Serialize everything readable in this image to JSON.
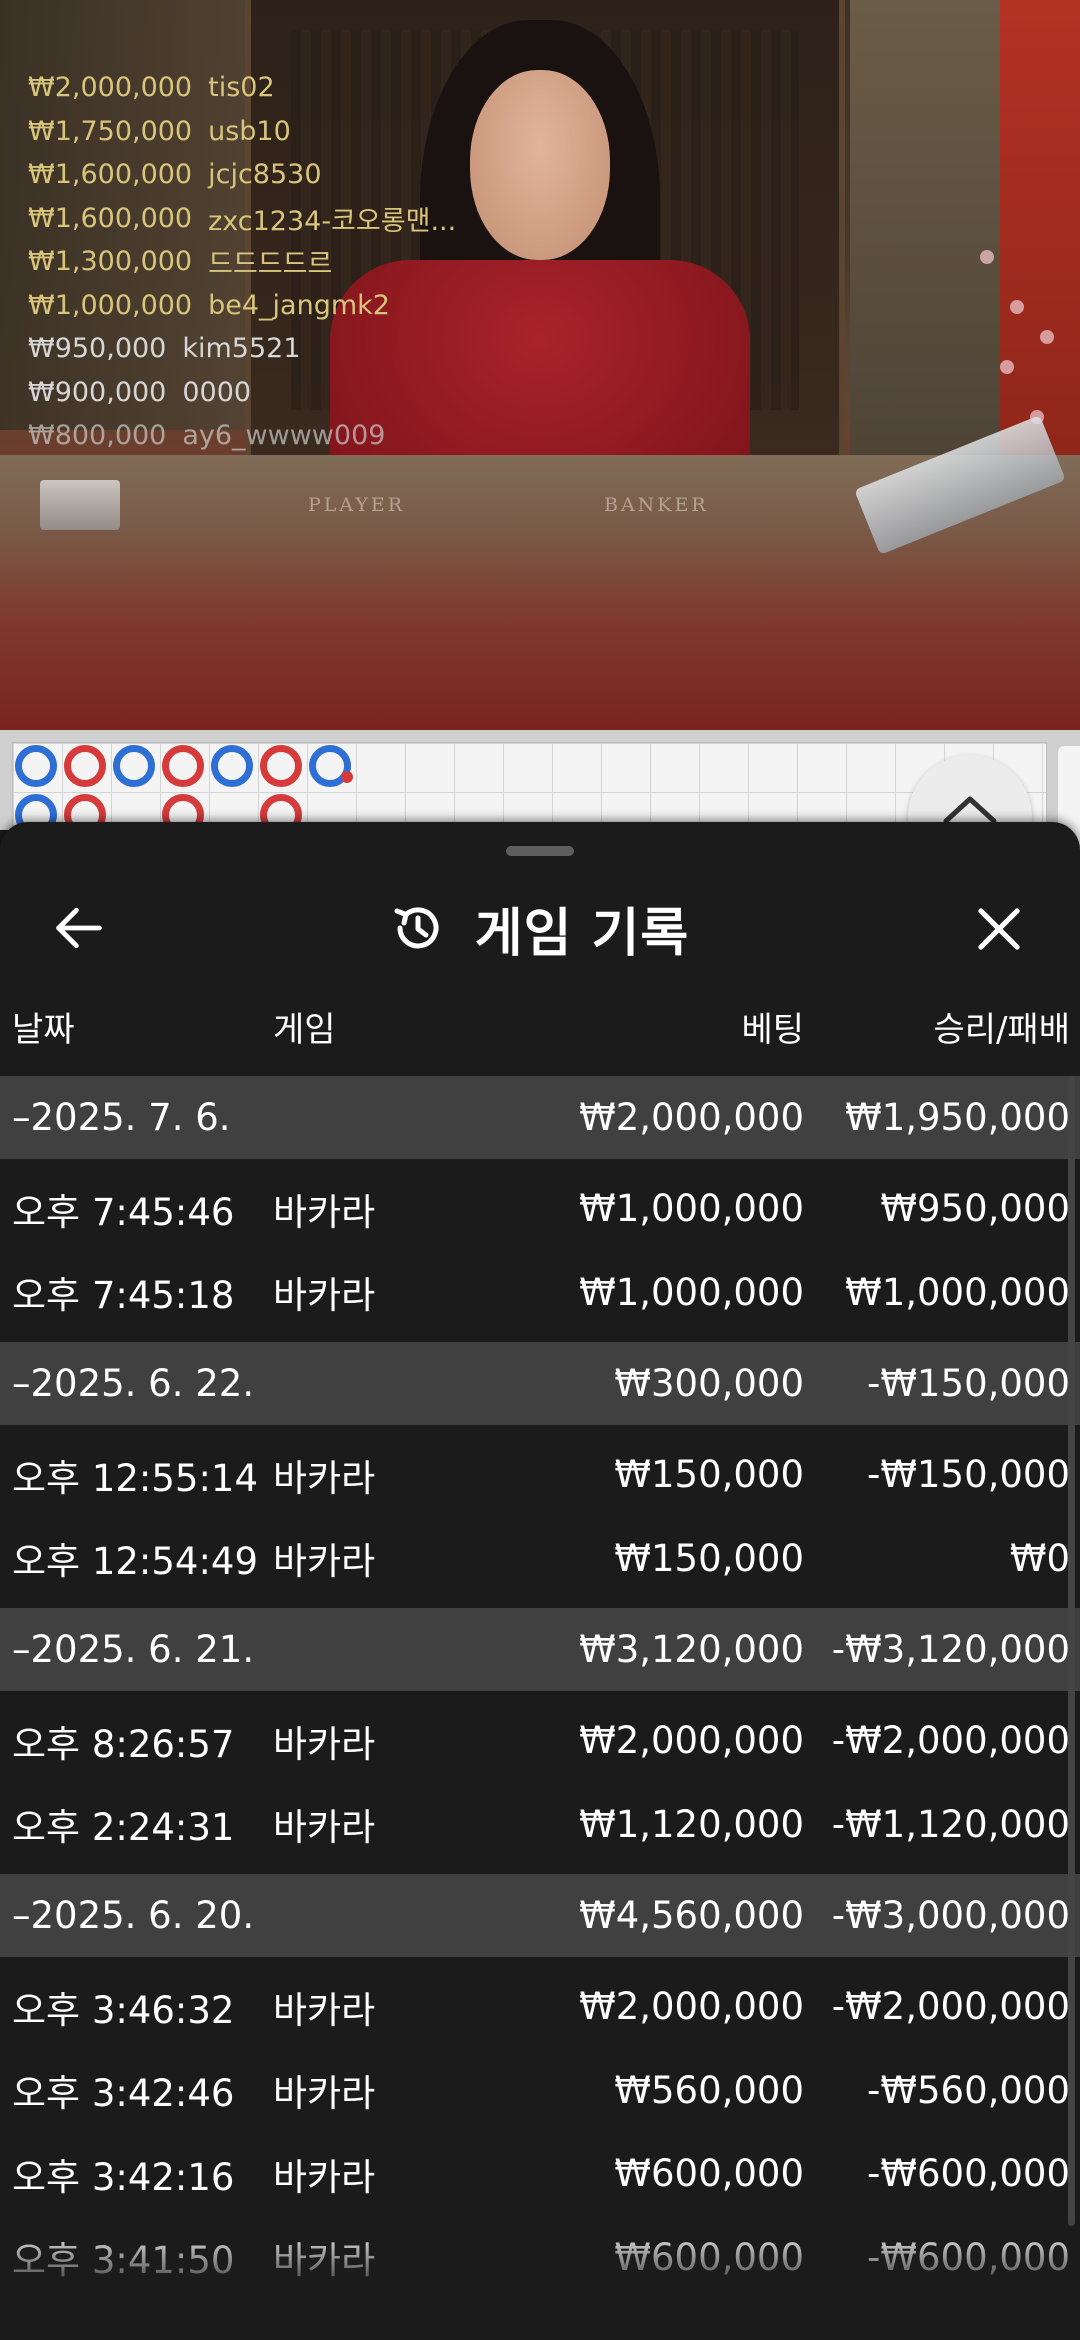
{
  "leaderboard": [
    {
      "amount": "₩2,000,000",
      "user": "tis02",
      "tier": "gold"
    },
    {
      "amount": "₩1,750,000",
      "user": "usb10",
      "tier": "gold"
    },
    {
      "amount": "₩1,600,000",
      "user": "jcjc8530",
      "tier": "gold"
    },
    {
      "amount": "₩1,600,000",
      "user": "zxc1234-코오롱맨...",
      "tier": "gold"
    },
    {
      "amount": "₩1,300,000",
      "user": "드드드드르",
      "tier": "gold"
    },
    {
      "amount": "₩1,000,000",
      "user": "be4_jangmk2",
      "tier": "gold"
    },
    {
      "amount": "₩950,000",
      "user": "kim5521",
      "tier": "silver"
    },
    {
      "amount": "₩900,000",
      "user": "0000",
      "tier": "silver"
    },
    {
      "amount": "₩800,000",
      "user": "ay6_wwww009",
      "tier": "silver"
    }
  ],
  "table_labels": {
    "player": "PLAYER",
    "banker": "BANKER"
  },
  "scoreboard": {
    "top_row": [
      "player",
      "banker",
      "player",
      "banker",
      "player",
      "banker",
      "player"
    ],
    "second_row": [
      "player",
      "banker",
      "",
      "banker",
      "",
      "banker"
    ]
  },
  "sheet": {
    "title": "게임 기록",
    "back_icon": "arrow-left-icon",
    "history_icon": "history-icon",
    "close_icon": "close-icon"
  },
  "columns": {
    "date": "날짜",
    "game": "게임",
    "bet": "베팅",
    "win_loss": "승리/패배"
  },
  "groups": [
    {
      "date": "–2025. 7. 6.",
      "bet": "₩2,000,000",
      "result": "₩1,950,000",
      "games": [
        {
          "time": "오후 7:45:46",
          "game": "바카라",
          "bet": "₩1,000,000",
          "result": "₩950,000"
        },
        {
          "time": "오후 7:45:18",
          "game": "바카라",
          "bet": "₩1,000,000",
          "result": "₩1,000,000"
        }
      ]
    },
    {
      "date": "–2025. 6. 22.",
      "bet": "₩300,000",
      "result": "-₩150,000",
      "games": [
        {
          "time": "오후 12:55:14",
          "game": "바카라",
          "bet": "₩150,000",
          "result": "-₩150,000"
        },
        {
          "time": "오후 12:54:49",
          "game": "바카라",
          "bet": "₩150,000",
          "result": "₩0"
        }
      ]
    },
    {
      "date": "–2025. 6. 21.",
      "bet": "₩3,120,000",
      "result": "-₩3,120,000",
      "games": [
        {
          "time": "오후 8:26:57",
          "game": "바카라",
          "bet": "₩2,000,000",
          "result": "-₩2,000,000"
        },
        {
          "time": "오후 2:24:31",
          "game": "바카라",
          "bet": "₩1,120,000",
          "result": "-₩1,120,000"
        }
      ]
    },
    {
      "date": "–2025. 6. 20.",
      "bet": "₩4,560,000",
      "result": "-₩3,000,000",
      "games": [
        {
          "time": "오후 3:46:32",
          "game": "바카라",
          "bet": "₩2,000,000",
          "result": "-₩2,000,000"
        },
        {
          "time": "오후 3:42:46",
          "game": "바카라",
          "bet": "₩560,000",
          "result": "-₩560,000"
        },
        {
          "time": "오후 3:42:16",
          "game": "바카라",
          "bet": "₩600,000",
          "result": "-₩600,000"
        },
        {
          "time": "오후 3:41:50",
          "game": "바카라",
          "bet": "₩600,000",
          "result": "-₩600,000"
        }
      ]
    }
  ]
}
